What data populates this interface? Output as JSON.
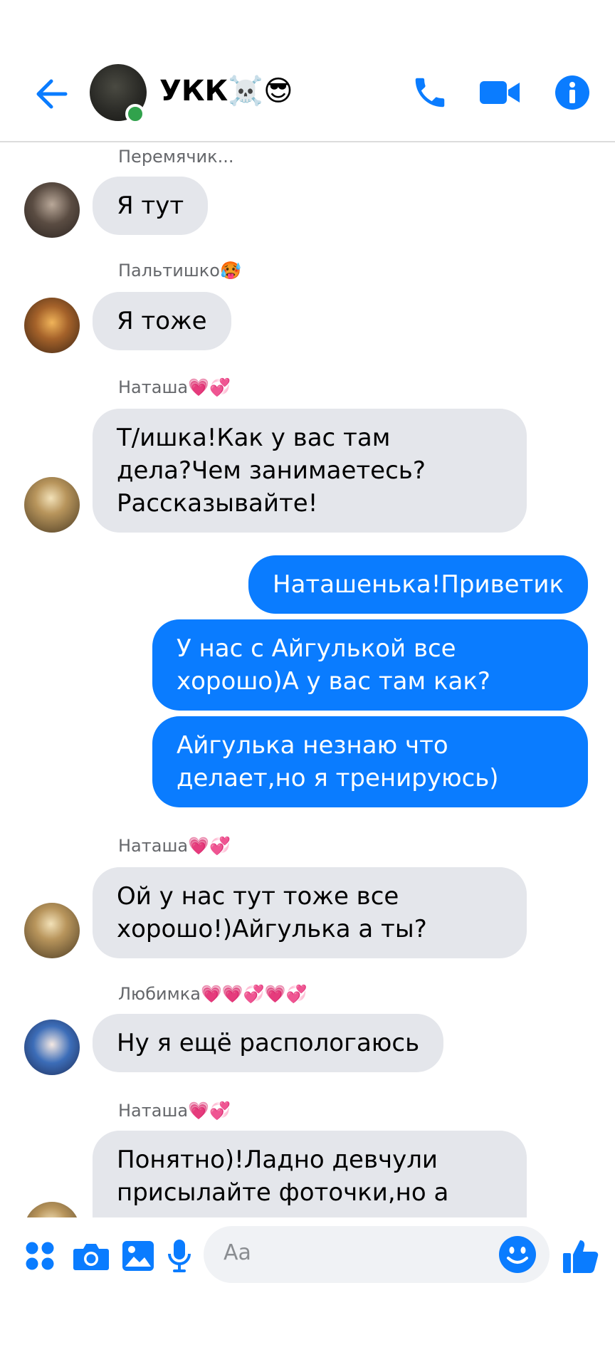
{
  "header": {
    "title": "УКК☠️😎",
    "icons": [
      "back-arrow-icon",
      "phone-icon",
      "video-icon",
      "info-icon"
    ],
    "accent_color": "#0a7cff"
  },
  "messages": [
    {
      "sender": "Перемячик...",
      "text": "Я тут",
      "direction": "in"
    },
    {
      "sender": "Пальтишко🥵",
      "text": "Я тоже",
      "direction": "in"
    },
    {
      "sender": "Наташа💗💞",
      "text": "Т/ишка!Как у вас там\nдела?Чем занимаетесь?\nРассказывайте!",
      "direction": "in"
    },
    {
      "text": "Наташенька!Приветик",
      "direction": "out"
    },
    {
      "text": "У нас с Айгулькой все\nхорошо)А у вас там как?",
      "direction": "out"
    },
    {
      "text": "Айгулька незнаю что\nделает,но я тренируюсь)",
      "direction": "out"
    },
    {
      "sender": "Наташа💗💞",
      "text": "Ой у нас тут тоже все\nхорошо!)Айгулька а ты?",
      "direction": "in"
    },
    {
      "sender": "Любимка💗💗💞💗💞",
      "text": "Ну я ещё распологаюсь",
      "direction": "in"
    },
    {
      "sender": "Наташа💗💞",
      "text": "Понятно)!Ладно девчули\nприсылайте фоточки,но а нам\nпора!До скорой встречи)",
      "direction": "in"
    }
  ],
  "composer": {
    "placeholder": "Aa",
    "icons": [
      "menu-grid-icon",
      "camera-icon",
      "gallery-icon",
      "microphone-icon",
      "emoji-icon",
      "thumbs-up-icon"
    ]
  }
}
